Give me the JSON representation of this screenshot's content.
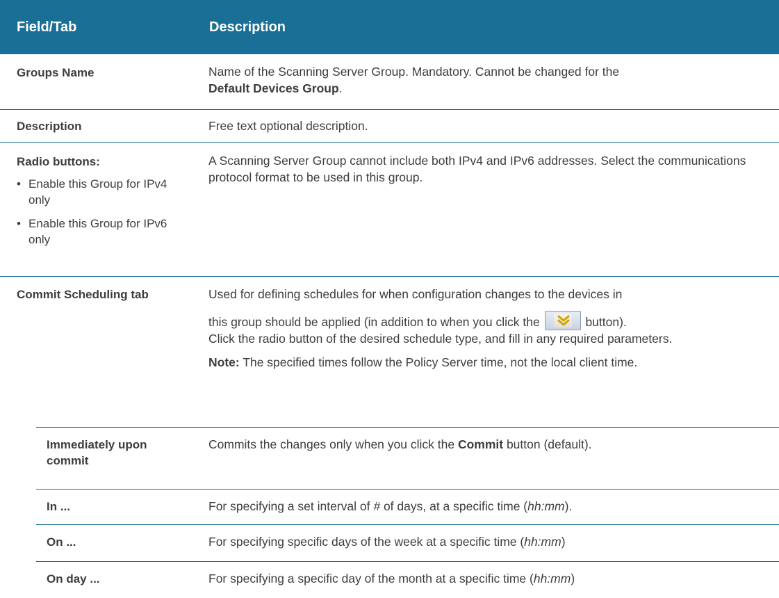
{
  "header": {
    "field_tab": "Field/Tab",
    "description": "Description"
  },
  "rows": {
    "groups_name": {
      "field": "Groups Name",
      "desc_1": "Name of the Scanning Server Group. Mandatory. Cannot be changed for the",
      "desc_bold": "Default Devices Group",
      "desc_end": "."
    },
    "description": {
      "field": "Description",
      "desc": "Free text optional description."
    },
    "radio_buttons": {
      "field": "Radio buttons:",
      "bullet_1": "Enable this Group for IPv4 only",
      "bullet_2": "Enable this Group for IPv6 only",
      "desc": "A Scanning Server Group cannot include both IPv4 and IPv6 addresses. Select the communications protocol format to be used in this group."
    },
    "commit_scheduling": {
      "field": "Commit Scheduling tab",
      "desc_line1": "Used for defining schedules for when configuration changes to the devices in",
      "desc_line2_pre": "this group should be applied (in addition to when you click the",
      "desc_line2_post": "button).",
      "desc_rest": "Click the radio button of the desired schedule type, and fill in any required parameters.",
      "note_label": "Note:",
      "note_text": "The specified times follow the Policy Server time, not the local client time.",
      "button_icon": "commit-icon"
    },
    "immediately": {
      "field": "Immediately upon commit",
      "desc_pre": "Commits the changes only when you click the",
      "desc_bold": "Commit",
      "desc_post": "button (default)."
    },
    "in": {
      "field": "In ...",
      "desc_pre": "For specifying a set interval of",
      "desc_hash": "#",
      "desc_mid": "of days, at a specific time (",
      "desc_time": "hh:mm",
      "desc_end": ")."
    },
    "on": {
      "field": "On ...",
      "desc_pre": "For specifying specific days of the week at a specific time (",
      "desc_time": "hh:mm",
      "desc_end": ")"
    },
    "on_day": {
      "field": "On day ...",
      "desc_pre": "For specifying a specific day of the month at a specific time (",
      "desc_time": "hh:mm",
      "desc_end": ")"
    }
  },
  "colors": {
    "header_bg": "#1a6f96",
    "header_text": "#ffffff",
    "body_text": "#3d3d3d",
    "rule": "#1a6f96"
  }
}
